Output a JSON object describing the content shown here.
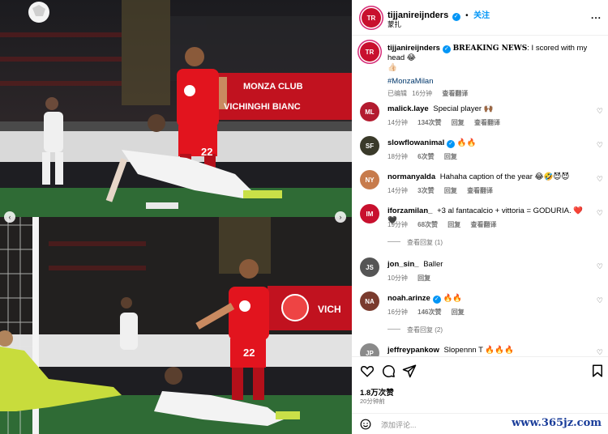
{
  "post": {
    "author": "tijjanireijnders",
    "follow_label": "关注",
    "subtitle": "蒙扎",
    "more_label": "...",
    "caption_prefix": "BREAKING NEWS",
    "caption_rest": ": I scored with my head 😂",
    "caption_emoji": "👍🏻",
    "hashtag": "#MonzaMilan",
    "caption_meta": [
      "已编辑",
      "16分钟",
      "查看翻译"
    ]
  },
  "comments": [
    {
      "user": "malick.laye",
      "verified": false,
      "text": "Special player 🙌🏾",
      "time": "14分钟",
      "likes": "134次赞",
      "reply": "回复",
      "translate": "查看翻译",
      "avatar_color": "#b31b2f",
      "avatar_initials": "ML"
    },
    {
      "user": "slowflowanimal",
      "verified": true,
      "text": "🔥🔥",
      "time": "18分钟",
      "likes": "6次赞",
      "reply": "回复",
      "translate": "",
      "avatar_color": "#3a3a2a",
      "avatar_initials": "SF"
    },
    {
      "user": "normanyalda",
      "verified": false,
      "text": "Hahaha caption of the year 😂🤣😈😈",
      "time": "14分钟",
      "likes": "3次赞",
      "reply": "回复",
      "translate": "查看翻译",
      "avatar_color": "#c77b4c",
      "avatar_initials": "NY"
    },
    {
      "user": "iforzamilan_",
      "verified": false,
      "text": "+3 al fantacalcio + vittoria = GODURIA. ❤️🖤",
      "time": "19分钟",
      "likes": "68次赞",
      "reply": "回复",
      "translate": "查看翻译",
      "avatar_color": "#c8102e",
      "avatar_initials": "IM",
      "view_replies": "查看回复 (1)"
    },
    {
      "user": "jon_sin_",
      "verified": false,
      "text": "Baller",
      "time": "10分钟",
      "likes": "",
      "reply": "回复",
      "translate": "",
      "avatar_color": "#555555",
      "avatar_initials": "JS"
    },
    {
      "user": "noah.arinze",
      "verified": true,
      "text": "🔥🔥",
      "time": "16分钟",
      "likes": "146次赞",
      "reply": "回复",
      "translate": "",
      "avatar_color": "#7a3b2e",
      "avatar_initials": "NA",
      "view_replies": "查看回复 (2)"
    },
    {
      "user": "jeffreypankow",
      "verified": false,
      "text": "Slopennn T 🔥🔥🔥",
      "time": "",
      "likes": "",
      "reply": "",
      "translate": "",
      "avatar_color": "#8a8a8a",
      "avatar_initials": "JP"
    }
  ],
  "footer": {
    "likes": "1.8万次赞",
    "time": "20分钟前",
    "add_comment_placeholder": "添加评论...",
    "watermark": "www.365jz.com"
  },
  "colors": {
    "accent_blue": "#0095f6",
    "monza_red": "#e2141e",
    "milan_white": "#f2f2f2",
    "pitch_green": "#2f6b35"
  },
  "icons": [
    "heart-icon",
    "comment-icon",
    "share-icon",
    "bookmark-icon",
    "emoji-icon",
    "more-icon",
    "chevron-left-icon",
    "chevron-right-icon",
    "verified-icon"
  ]
}
